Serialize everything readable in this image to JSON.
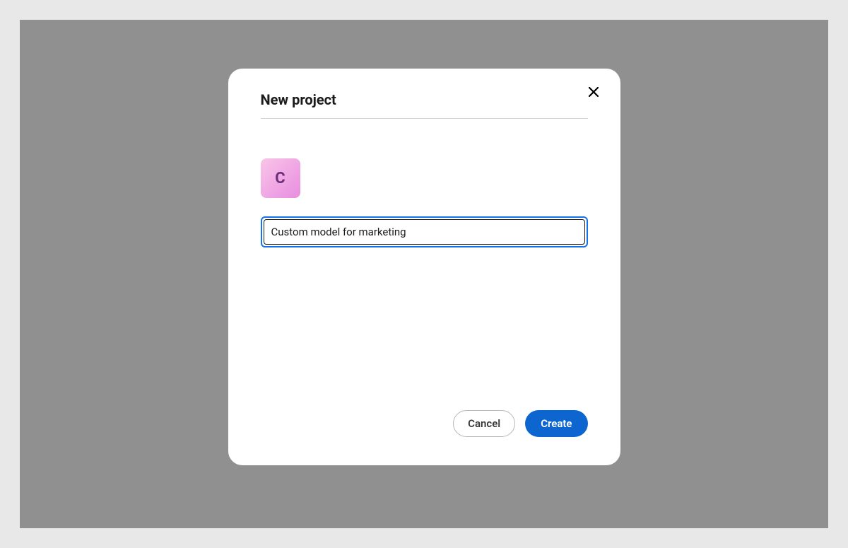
{
  "dialog": {
    "title": "New project",
    "thumbnail_letter": "C",
    "project_name_value": "Custom model for marketing",
    "cancel_label": "Cancel",
    "create_label": "Create"
  }
}
